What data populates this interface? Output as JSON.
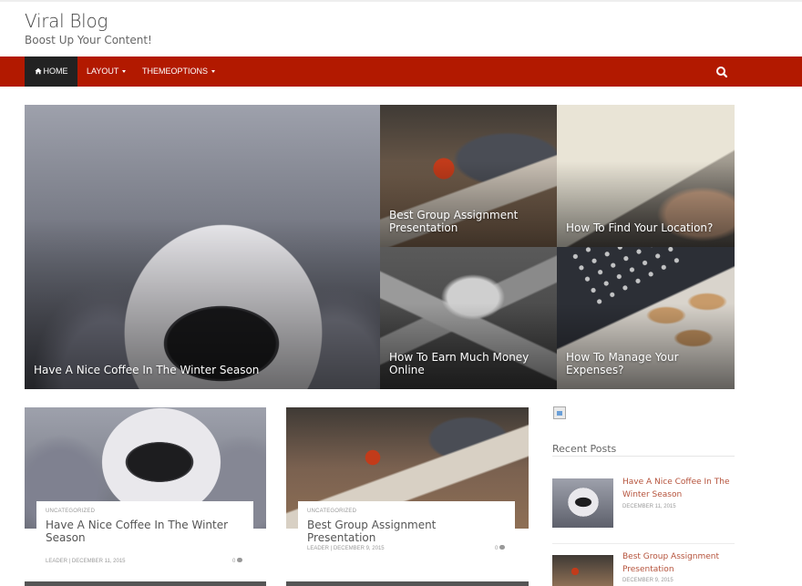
{
  "site": {
    "title": "Viral Blog",
    "tagline": "Boost Up Your Content!"
  },
  "colors": {
    "nav_bg": "#b21900",
    "nav_active": "#222222",
    "link": "#b5523b"
  },
  "nav": {
    "items": [
      {
        "label": "HOME",
        "icon": "home-icon",
        "active": true
      },
      {
        "label": "LAYOUT",
        "dropdown": true
      },
      {
        "label": "THEMEOPTIONS",
        "dropdown": true
      }
    ],
    "search_icon": "search-icon"
  },
  "featured": [
    {
      "title": "Have A Nice Coffee In The Winter Season"
    },
    {
      "title": "Best Group Assignment Presentation"
    },
    {
      "title": "How To Find Your Location?"
    },
    {
      "title": "How To Earn Much Money Online"
    },
    {
      "title": "How To Manage Your Expenses?"
    }
  ],
  "posts": [
    {
      "category": "UNCATEGORIZED",
      "title": "Have A Nice Coffee In The Winter Season",
      "author": "LEADER",
      "date": "DECEMBER 11, 2015",
      "comments": "0"
    },
    {
      "category": "UNCATEGORIZED",
      "title": "Best Group Assignment Presentation",
      "author": "LEADER",
      "date": "DECEMBER 9, 2015",
      "comments": "0"
    }
  ],
  "sidebar": {
    "recent_posts_title": "Recent Posts",
    "recent": [
      {
        "title": "Have A Nice Coffee In The Winter Season",
        "date": "DECEMBER 11, 2015"
      },
      {
        "title": "Best Group Assignment Presentation",
        "date": "DECEMBER 9, 2015"
      }
    ]
  }
}
